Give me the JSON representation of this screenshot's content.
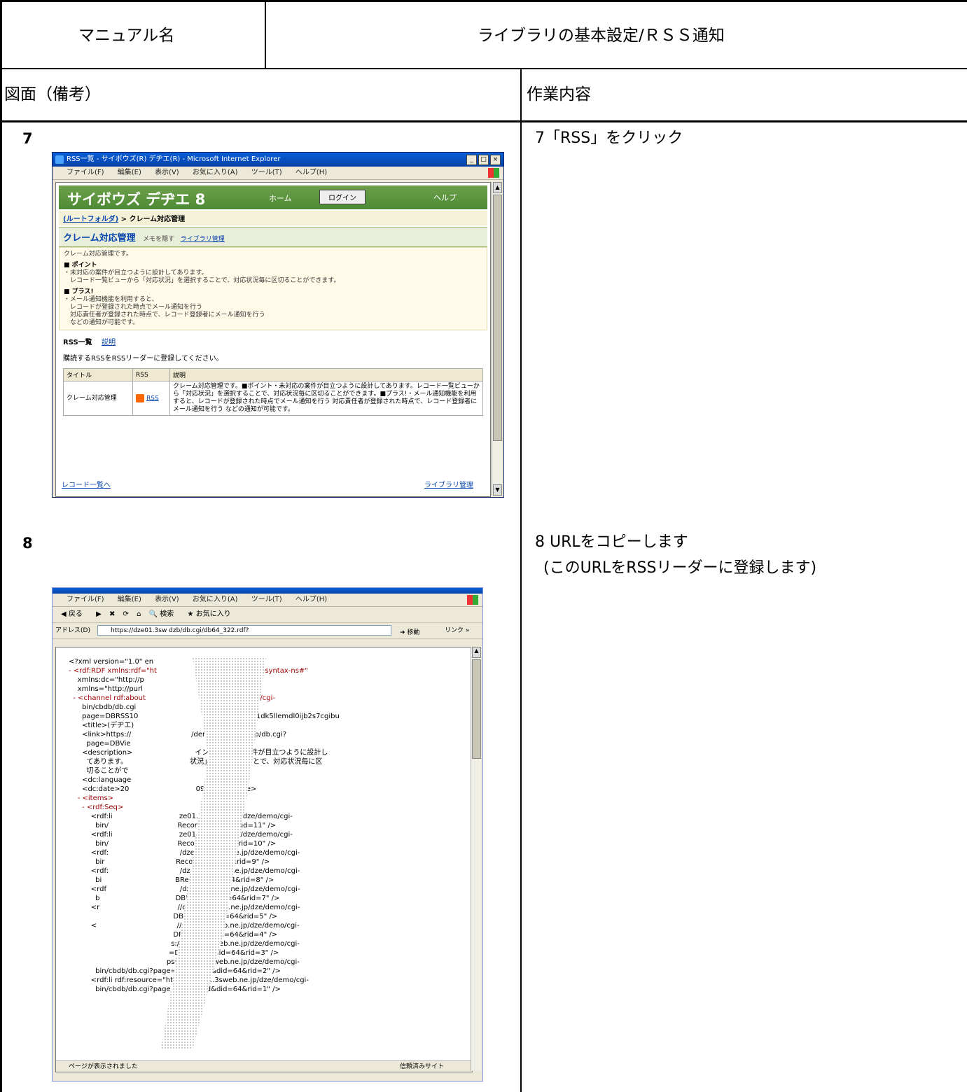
{
  "header": {
    "manual_label": "マニュアル名",
    "manual_name": "ライブラリの基本設定/ＲＳＳ通知",
    "figure_label": "図面（備考）",
    "work_label": "作業内容"
  },
  "steps": [
    {
      "number": "7",
      "work_text": "7「RSS」をクリック"
    },
    {
      "number": "8",
      "work_text": "8 URLをコピーします",
      "work_sub": "(このURLをRSSリーダーに登録します)"
    }
  ],
  "screenshot1": {
    "window_title": "RSS一覧 - サイボウズ(R) デヂエ(R) - Microsoft Internet Explorer",
    "menu": [
      "ファイル(F)",
      "編集(E)",
      "表示(V)",
      "お気に入り(A)",
      "ツール(T)",
      "ヘルプ(H)"
    ],
    "logo": "サイボウズ デヂエ 8",
    "home": "ホーム",
    "login": "ログイン",
    "help": "ヘルプ",
    "breadcrumb_root": "(ルートフォルダ)",
    "breadcrumb_current": "> クレーム対応管理",
    "app_title": "クレーム対応管理",
    "memo_link": "メモを隠す",
    "library_link": "ライブラリ管理",
    "desc_lines": [
      "クレーム対応管理です。",
      "■ ポイント",
      "・未対応の案件が目立つように設計してあります。",
      "　レコード一覧ビューから「対応状況」を選択することで、対応状況毎に区切ることができます。",
      "■ プラス!",
      "・メール通知機能を利用すると、",
      "　レコードが登録された時点でメール通知を行う",
      "　対応責任者が登録された時点で、レコード登録者にメール通知を行う",
      "　などの通知が可能です。"
    ],
    "rss_list_title": "RSS一覧",
    "rss_explain_link": "説明",
    "rss_note": "購読するRSSをRSSリーダーに登録してください。",
    "table_headers": [
      "タイトル",
      "RSS",
      "説明"
    ],
    "table_row": {
      "title": "クレーム対応管理",
      "rss": "RSS",
      "desc": "クレーム対応管理です。■ポイント・未対応の案件が目立つように設計してあります。レコード一覧ビューから「対応状況」を選択することで、対応状況毎に区切ることができます。■プラス!・メール通知機能を利用すると、レコードが登録された時点でメール通知を行う 対応責任者が登録された時点で、レコード登録者にメール通知を行う などの通知が可能です。"
    },
    "back_link": "レコード一覧へ",
    "bottom_library_link": "ライブラリ管理"
  },
  "screenshot2": {
    "menu": [
      "ファイル(F)",
      "編集(E)",
      "表示(V)",
      "お気に入り(A)",
      "ツール(T)",
      "ヘルプ(H)"
    ],
    "toolbar": [
      "戻る",
      "検索",
      "お気に入り"
    ],
    "address_label": "アドレス(D)",
    "address_value": "https://dze01.3sw                          dzb/db.cgi/db64_322.rdf?",
    "go_label": "移動",
    "links_label": "リンク »",
    "xml_lines": [
      "<?xml version=\"1.0\" en",
      "- <rdf:RDF xmlns:rdf=\"ht                              9/02/22-rdf-syntax-ns#\"",
      "    xmlns:dc=\"http://p                               1/\"",
      "    xmlns=\"http://purl                              =\"ja\">",
      "  - <channel rdf:about                          .ne.jp/dze/demo/cgi-",
      "      bin/cbdb/db.cgi",
      "      page=DBRSS10                             y=jeygtgo1ybk1dk5llemdl0ijb2s7cgibu",
      "      <title>(デヂエ)",
      "      <link>https://                           /demo/cgi-bin/cbdb/db.cgi?",
      "        page=DBVie",
      "      <description>                            イント未対応の案件が目立つように設計し",
      "        てあります。                            状況」を選択することで、対応状況毎に区",
      "        切ることがで",
      "      <dc:language",
      "      <dc:date>20                              09:00</dc:date>",
      "    - <items>",
      "      - <rdf:Seq>",
      "          <rdf:li                              ze01.3sweb.ne.jp/dze/demo/cgi-",
      "            bin/                               Record&did=64&rid=11\" />",
      "          <rdf:li                              ze01.3sweb.ne.jp/dze/demo/cgi-",
      "            bin/                               Record&did=64&rid=10\" />",
      "          <rdf:                                /dze01.3sweb.ne.jp/dze/demo/cgi-",
      "            bir                                Record&did=64&rid=9\" />",
      "          <rdf:                                /dze01.3sweb.ne.jp/dze/demo/cgi-",
      "            bi                                 BRecord&did=64&rid=8\" />",
      "          <rdf                                 /dze01.3sweb.ne.jp/dze/demo/cgi-",
      "            b                                  DBRecord&did=64&rid=7\" />",
      "          <r                                   //dze01.3sweb.ne.jp/dze/demo/cgi-",
      "                                               DBRecord&did=64&rid=5\" />",
      "          <                                    //dze01.3sweb.ne.jp/dze/demo/cgi-",
      "                                               DBRecord&did=64&rid=4\" />",
      "                                              s://dze01.3sweb.ne.jp/dze/demo/cgi-",
      "                                             =DBRecord&did=64&rid=3\" />",
      "                                            ps://dze01.3sweb.ne.jp/dze/demo/cgi-",
      "            bin/cbdb/db.cgi?page=DBRecord&did=64&rid=2\" />",
      "          <rdf:li rdf:resource=\"https://dze01.3sweb.ne.jp/dze/demo/cgi-",
      "            bin/cbdb/db.cgi?page=DBRecord&did=64&rid=1\" />"
    ],
    "status_text": "ページが表示されました",
    "zone_text": "信頼済みサイト"
  }
}
